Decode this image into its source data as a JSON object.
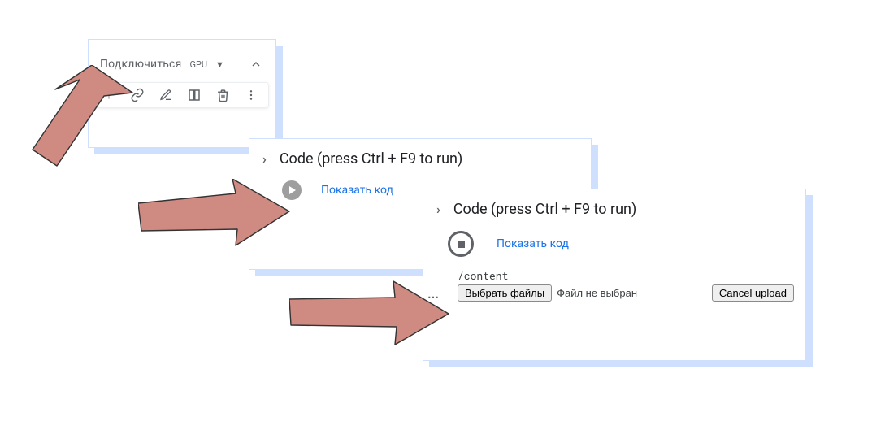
{
  "card1": {
    "connect_label": "Подключиться",
    "runtime_type": "GPU"
  },
  "card2": {
    "title": "Code (press Ctrl + F9 to run)",
    "show_code": "Показать код"
  },
  "card3": {
    "title": "Code (press Ctrl + F9 to run)",
    "show_code": "Показать код",
    "cwd": "/content",
    "choose_files_label": "Выбрать файлы",
    "file_status": "Файл не выбран",
    "cancel_label": "Cancel upload"
  },
  "arrows": [
    "arrow-1",
    "arrow-2",
    "arrow-3"
  ]
}
